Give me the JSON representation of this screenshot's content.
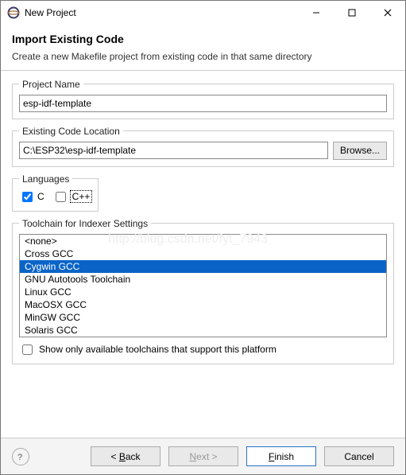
{
  "window": {
    "title": "New Project"
  },
  "header": {
    "title": "Import Existing Code",
    "description": "Create a new Makefile project from existing code in that same directory"
  },
  "projectName": {
    "legend": "Project Name",
    "value": "esp-idf-template"
  },
  "codeLocation": {
    "legend": "Existing Code Location",
    "value": "C:\\ESP32\\esp-idf-template",
    "browseLabel": "Browse..."
  },
  "languages": {
    "legend": "Languages",
    "c": {
      "label": "C",
      "checked": true
    },
    "cpp": {
      "label": "C++",
      "checked": false
    }
  },
  "toolchain": {
    "legend": "Toolchain for Indexer Settings",
    "items": [
      "<none>",
      "Cross GCC",
      "Cygwin GCC",
      "GNU Autotools Toolchain",
      "Linux GCC",
      "MacOSX GCC",
      "MinGW GCC",
      "Solaris GCC"
    ],
    "selectedIndex": 2,
    "showOnlyLabel": "Show only available toolchains that support this platform",
    "showOnlyChecked": false
  },
  "buttons": {
    "back": "< Back",
    "next": "Next >",
    "finish": "Finish",
    "cancel": "Cancel"
  },
  "watermark": "http://blog.csdn.net/fyt_7943"
}
